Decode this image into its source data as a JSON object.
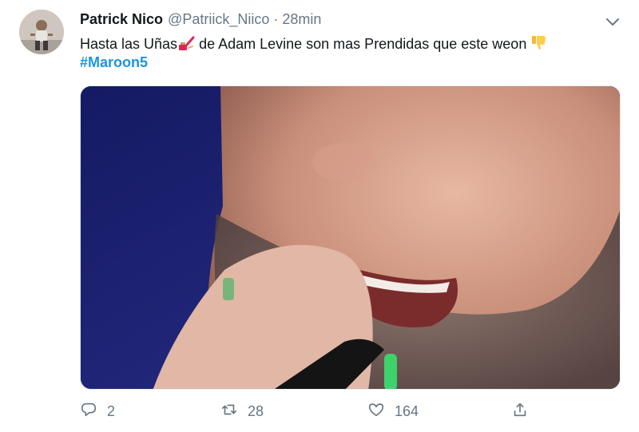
{
  "tweet": {
    "display_name": "Patrick Nico",
    "handle": "@Patriick_Niico",
    "separator": "·",
    "time": "28min",
    "text_before_emoji": "Hasta las Uñas",
    "text_after_emoji": " de Adam Levine son mas Prendidas que este weon ",
    "hashtag": "#Maroon5",
    "emojis": [
      "nail-polish-icon",
      "thumbs-down-icon"
    ],
    "media_description_icon": "singer-closeup-photo"
  },
  "actions": {
    "reply_count": "2",
    "retweet_count": "28",
    "like_count": "164"
  },
  "colors": {
    "link": "#1b95e0",
    "muted": "#657786",
    "text": "#14171a"
  }
}
